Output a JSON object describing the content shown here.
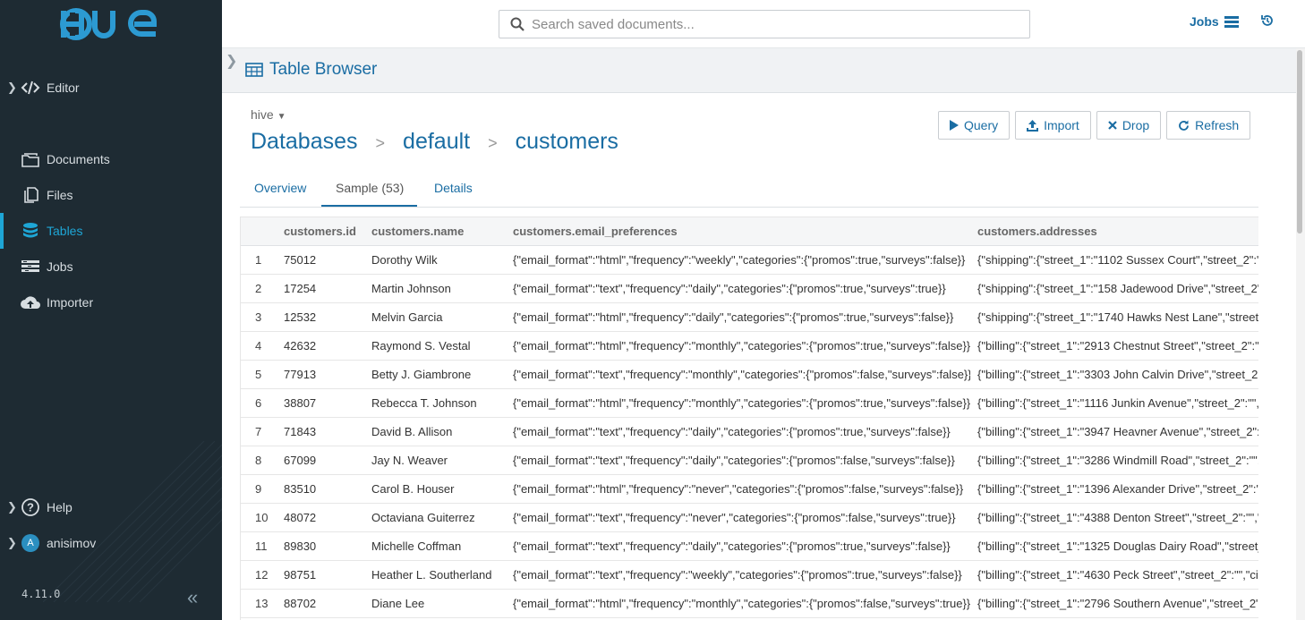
{
  "sidebar": {
    "brand": "HUE",
    "items": [
      {
        "label": "Editor",
        "icon": "code-icon",
        "chevron": true
      },
      {
        "label": "Documents",
        "icon": "documents-icon"
      },
      {
        "label": "Files",
        "icon": "files-icon"
      },
      {
        "label": "Tables",
        "icon": "database-icon",
        "active": true
      },
      {
        "label": "Jobs",
        "icon": "jobs-icon"
      },
      {
        "label": "Importer",
        "icon": "upload-cloud-icon"
      }
    ],
    "help_label": "Help",
    "user_initial": "A",
    "user_name": "anisimov",
    "version": "4.11.0"
  },
  "topbar": {
    "search_placeholder": "Search saved documents...",
    "jobs_label": "Jobs"
  },
  "app": {
    "title": "Table Browser"
  },
  "breadcrumb": {
    "engine": "hive",
    "items": [
      "Databases",
      "default",
      "customers"
    ],
    "separator": ">"
  },
  "actions": {
    "query": "Query",
    "import": "Import",
    "drop": "Drop",
    "refresh": "Refresh"
  },
  "tabs": [
    "Overview",
    "Sample (53)",
    "Details"
  ],
  "active_tab": "Sample (53)",
  "table": {
    "columns": [
      "",
      "customers.id",
      "customers.name",
      "customers.email_preferences",
      "customers.addresses"
    ],
    "rows": [
      [
        "1",
        "75012",
        "Dorothy Wilk",
        "{\"email_format\":\"html\",\"frequency\":\"weekly\",\"categories\":{\"promos\":true,\"surveys\":false}}",
        "{\"shipping\":{\"street_1\":\"1102 Sussex Court\",\"street_2\":\"\","
      ],
      [
        "2",
        "17254",
        "Martin Johnson",
        "{\"email_format\":\"text\",\"frequency\":\"daily\",\"categories\":{\"promos\":true,\"surveys\":true}}",
        "{\"shipping\":{\"street_1\":\"158 Jadewood Drive\",\"street_2\":\""
      ],
      [
        "3",
        "12532",
        "Melvin Garcia",
        "{\"email_format\":\"html\",\"frequency\":\"daily\",\"categories\":{\"promos\":true,\"surveys\":false}}",
        "{\"shipping\":{\"street_1\":\"1740 Hawks Nest Lane\",\"street_"
      ],
      [
        "4",
        "42632",
        "Raymond S. Vestal",
        "{\"email_format\":\"html\",\"frequency\":\"monthly\",\"categories\":{\"promos\":true,\"surveys\":false}}",
        "{\"billing\":{\"street_1\":\"2913 Chestnut Street\",\"street_2\":\"\","
      ],
      [
        "5",
        "77913",
        "Betty J. Giambrone",
        "{\"email_format\":\"text\",\"frequency\":\"monthly\",\"categories\":{\"promos\":false,\"surveys\":false}}",
        "{\"billing\":{\"street_1\":\"3303 John Calvin Drive\",\"street_2\":\""
      ],
      [
        "6",
        "38807",
        "Rebecca T. Johnson",
        "{\"email_format\":\"html\",\"frequency\":\"monthly\",\"categories\":{\"promos\":true,\"surveys\":false}}",
        "{\"billing\":{\"street_1\":\"1116 Junkin Avenue\",\"street_2\":\"\",\"c"
      ],
      [
        "7",
        "71843",
        "David B. Allison",
        "{\"email_format\":\"text\",\"frequency\":\"daily\",\"categories\":{\"promos\":true,\"surveys\":false}}",
        "{\"billing\":{\"street_1\":\"3947 Heavner Avenue\",\"street_2\":\"\","
      ],
      [
        "8",
        "67099",
        "Jay N. Weaver",
        "{\"email_format\":\"text\",\"frequency\":\"daily\",\"categories\":{\"promos\":false,\"surveys\":false}}",
        "{\"billing\":{\"street_1\":\"3286 Windmill Road\",\"street_2\":\"\",\"c"
      ],
      [
        "9",
        "83510",
        "Carol B. Houser",
        "{\"email_format\":\"html\",\"frequency\":\"never\",\"categories\":{\"promos\":false,\"surveys\":false}}",
        "{\"billing\":{\"street_1\":\"1396 Alexander Drive\",\"street_2\":\"\","
      ],
      [
        "10",
        "48072",
        "Octaviana Guiterrez",
        "{\"email_format\":\"text\",\"frequency\":\"never\",\"categories\":{\"promos\":false,\"surveys\":true}}",
        "{\"billing\":{\"street_1\":\"4388 Denton Street\",\"street_2\":\"\",\"ci"
      ],
      [
        "11",
        "89830",
        "Michelle Coffman",
        "{\"email_format\":\"text\",\"frequency\":\"daily\",\"categories\":{\"promos\":true,\"surveys\":false}}",
        "{\"billing\":{\"street_1\":\"1325 Douglas Dairy Road\",\"street_2"
      ],
      [
        "12",
        "98751",
        "Heather L. Southerland",
        "{\"email_format\":\"text\",\"frequency\":\"weekly\",\"categories\":{\"promos\":true,\"surveys\":false}}",
        "{\"billing\":{\"street_1\":\"4630 Peck Street\",\"street_2\":\"\",\"city"
      ],
      [
        "13",
        "88702",
        "Diane Lee",
        "{\"email_format\":\"html\",\"frequency\":\"monthly\",\"categories\":{\"promos\":false,\"surveys\":true}}",
        "{\"billing\":{\"street_1\":\"2796 Southern Avenue\",\"street_2\":\""
      ]
    ]
  },
  "colors": {
    "sidebar_bg": "#1e2b33",
    "accent": "#1a6da3",
    "active_nav": "#1ea6d6"
  }
}
